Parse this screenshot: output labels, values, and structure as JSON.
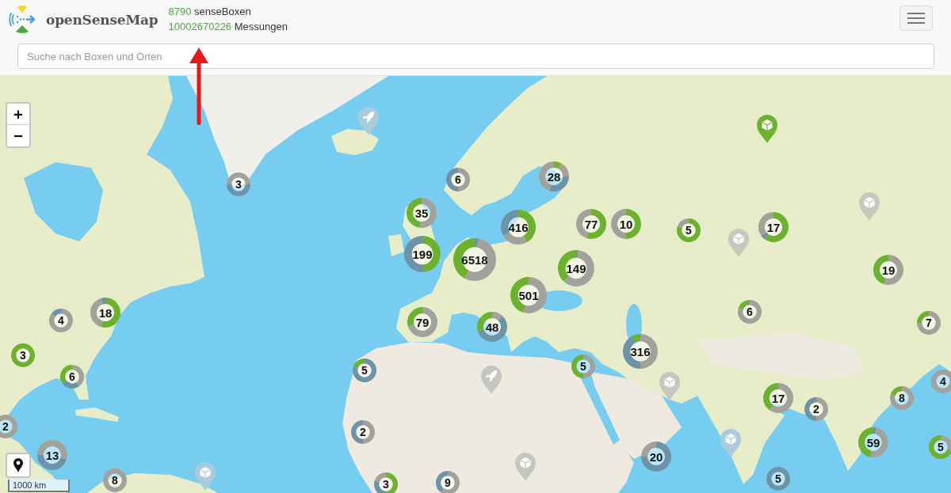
{
  "header": {
    "title": "openSenseMap",
    "stats": [
      {
        "count": "8790",
        "unit": "senseBoxen"
      },
      {
        "count": "10002670226",
        "unit": "Messungen"
      }
    ]
  },
  "search": {
    "placeholder": "Suche nach Boxen und Orten"
  },
  "map": {
    "zoom_controls": [
      "+",
      "−"
    ],
    "clusters": [
      {
        "count": "3"
      },
      {
        "count": "18"
      },
      {
        "count": "4"
      },
      {
        "count": "3"
      },
      {
        "count": "6"
      },
      {
        "count": "2"
      },
      {
        "count": "13"
      },
      {
        "count": "8"
      },
      {
        "count": "6"
      },
      {
        "count": "28"
      },
      {
        "count": "35"
      },
      {
        "count": "416"
      },
      {
        "count": "77"
      },
      {
        "count": "10"
      },
      {
        "count": "199"
      },
      {
        "count": "6518"
      },
      {
        "count": "149"
      },
      {
        "count": "501"
      },
      {
        "count": "79"
      },
      {
        "count": "48"
      },
      {
        "count": "5"
      },
      {
        "count": "5"
      },
      {
        "count": "2"
      },
      {
        "count": "3"
      },
      {
        "count": "9"
      },
      {
        "count": "5"
      },
      {
        "count": "17"
      },
      {
        "count": "316"
      },
      {
        "count": "6"
      },
      {
        "count": "19"
      },
      {
        "count": "7"
      },
      {
        "count": "4"
      },
      {
        "count": "17"
      },
      {
        "count": "2"
      },
      {
        "count": "8"
      },
      {
        "count": "20"
      },
      {
        "count": "59"
      },
      {
        "count": "5"
      },
      {
        "count": "5"
      }
    ],
    "markers": [
      {
        "color": "#a9cbdb"
      },
      {
        "color": "#c6c6c0"
      },
      {
        "color": "#c6c6c0"
      },
      {
        "color": "#a9cbdb"
      },
      {
        "color": "#6cb22e"
      },
      {
        "color": "#c6c8be"
      },
      {
        "color": "#c6c8be"
      },
      {
        "color": "#c6c6c0"
      },
      {
        "color": "#a9cbdb"
      }
    ],
    "scale": "1000 km"
  }
}
